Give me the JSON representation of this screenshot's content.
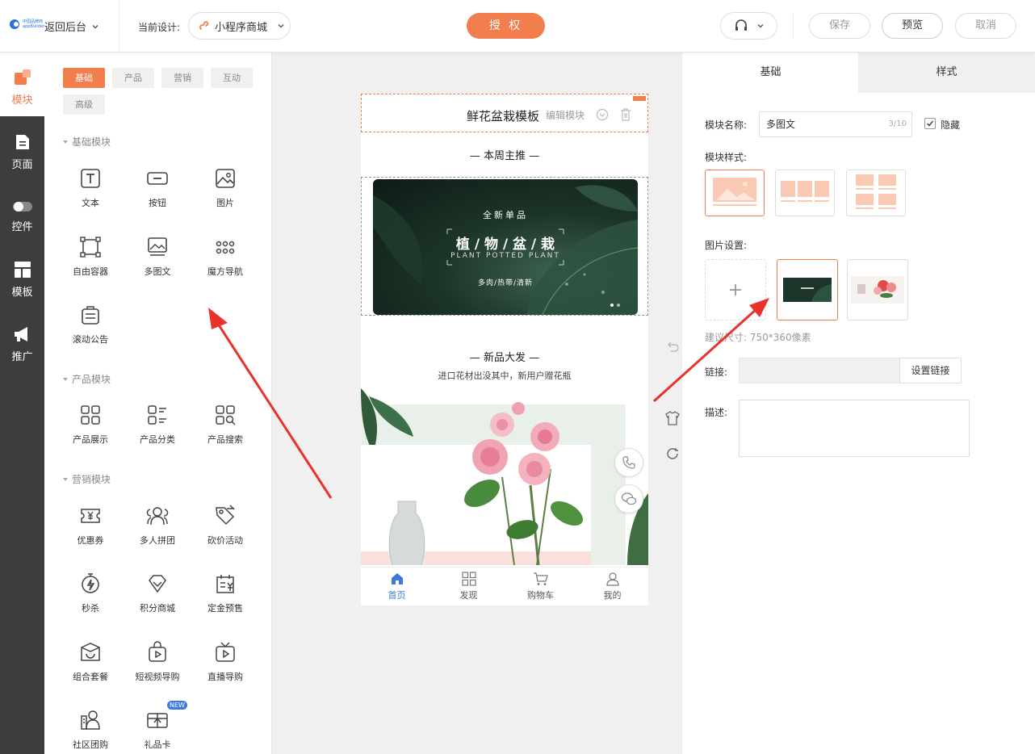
{
  "topbar": {
    "logo_text": "中国品牌商 appBuilder",
    "back_label": "返回后台",
    "current_design_label": "当前设计:",
    "design_select_value": "小程序商城",
    "authorize_label": "授 权",
    "save_label": "保存",
    "preview_label": "预览",
    "cancel_label": "取消"
  },
  "rail": [
    {
      "label": "模块",
      "icon": "module-icon"
    },
    {
      "label": "页面",
      "icon": "page-icon"
    },
    {
      "label": "控件",
      "icon": "toggle-icon"
    },
    {
      "label": "模板",
      "icon": "template-icon"
    },
    {
      "label": "推广",
      "icon": "megaphone-icon"
    }
  ],
  "category_tabs": [
    "基础",
    "产品",
    "营销",
    "互动",
    "高级"
  ],
  "sections": {
    "basic": "基础模块",
    "product": "产品模块",
    "marketing": "营销模块"
  },
  "modules": {
    "text": "文本",
    "button": "按钮",
    "image": "图片",
    "free_container": "自由容器",
    "multi_image_text": "多图文",
    "magic_nav": "魔方导航",
    "scroll_notice": "滚动公告",
    "product_show": "产品展示",
    "product_category": "产品分类",
    "product_search": "产品搜索",
    "coupon": "优惠券",
    "group_buy": "多人拼团",
    "bargain": "砍价活动",
    "flash_sale": "秒杀",
    "points_mall": "积分商城",
    "deposit_presale": "定金预售",
    "combo": "组合套餐",
    "short_video": "短视频导购",
    "live_guide": "直播导购",
    "community_group": "社区团购",
    "gift_card": "礼品卡",
    "new_badge": "NEW"
  },
  "phone": {
    "title": "鲜花盆栽模板",
    "edit_module_label": "编辑模块",
    "section1_title": "— 本周主推 —",
    "banner": {
      "kicker": "全新单品",
      "headline": "植 / 物 / 盆 / 栽",
      "english": "PLANT POTTED PLANT",
      "tagline": "多肉/热带/清新"
    },
    "section2_title": "— 新品大发 —",
    "section2_subtitle": "进口花材出没其中，新用户赠花瓶",
    "tabs": [
      {
        "label": "首页",
        "icon": "home-icon"
      },
      {
        "label": "发现",
        "icon": "grid-icon"
      },
      {
        "label": "购物车",
        "icon": "cart-icon"
      },
      {
        "label": "我的",
        "icon": "user-icon"
      }
    ]
  },
  "right": {
    "tab_basic": "基础",
    "tab_style": "样式",
    "name_label": "模块名称:",
    "name_value": "多图文",
    "name_count": "3/10",
    "hide_label": "隐藏",
    "hide_checked": true,
    "style_label": "模块样式:",
    "image_settings_label": "图片设置:",
    "suggest_size": "建议尺寸: 750*360像素",
    "link_label": "链接:",
    "set_link_label": "设置链接",
    "desc_label": "描述:"
  },
  "colors": {
    "accent": "#f27d4d",
    "rail_bg": "#3d3d3d",
    "tab_active": "#3b7be0",
    "annotation_arrow": "#e8322b"
  }
}
